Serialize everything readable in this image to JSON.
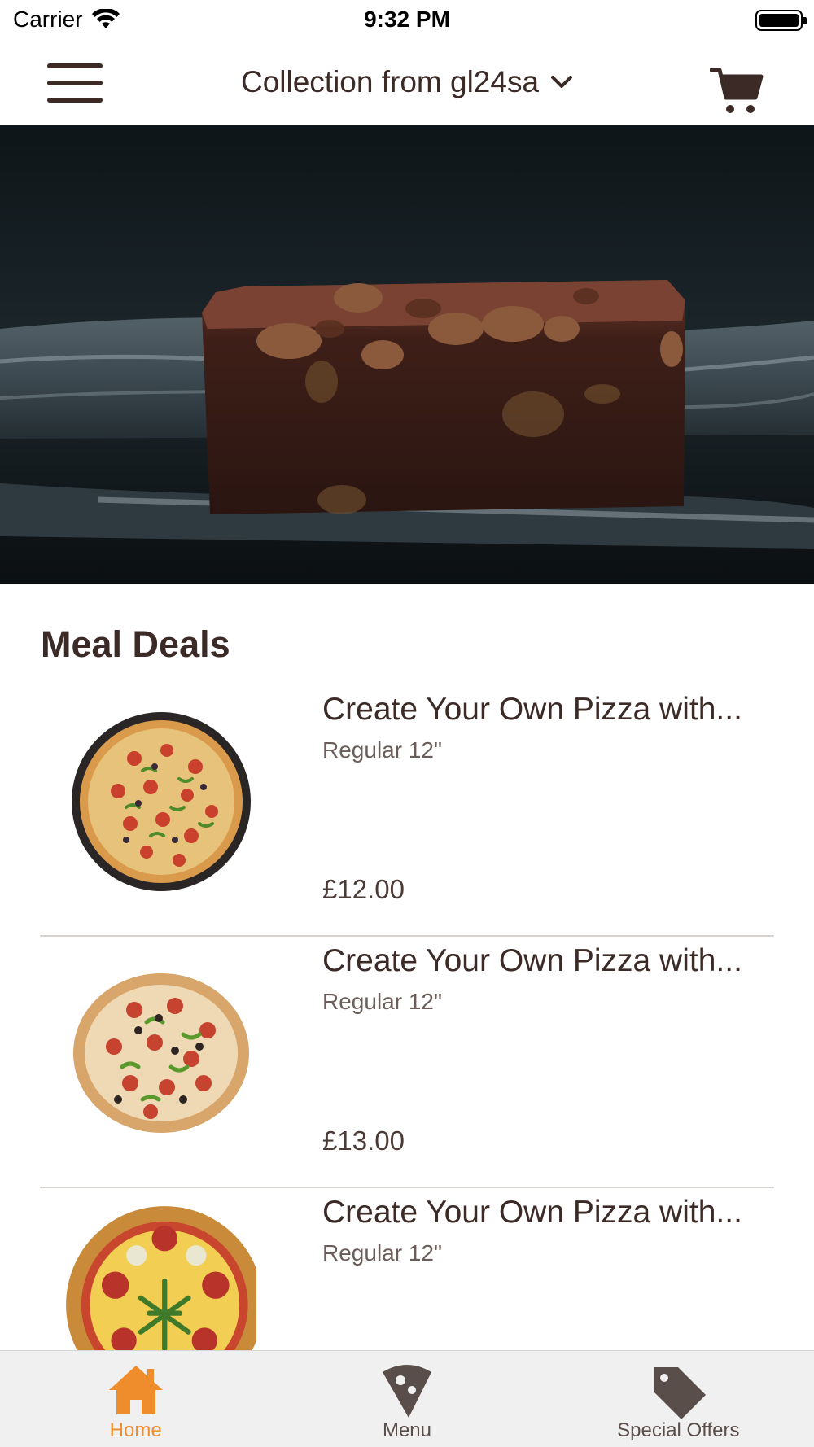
{
  "status_bar": {
    "carrier": "Carrier",
    "time": "9:32 PM"
  },
  "header": {
    "location_label": "Collection from gl24sa"
  },
  "hero": {
    "image_alt": "Chocolate walnut brownie"
  },
  "meal_deals": {
    "title": "Meal Deals",
    "items": [
      {
        "name": "Create Your Own Pizza with...",
        "size": "Regular 12\"",
        "price": "£12.00"
      },
      {
        "name": "Create Your Own Pizza with...",
        "size": "Regular 12\"",
        "price": "£13.00"
      },
      {
        "name": "Create Your Own Pizza with...",
        "size": "Regular 12\"",
        "price": ""
      }
    ]
  },
  "tab_bar": {
    "tabs": [
      {
        "label": "Home",
        "icon": "home-icon",
        "active": true
      },
      {
        "label": "Menu",
        "icon": "pizza-slice-icon",
        "active": false
      },
      {
        "label": "Special Offers",
        "icon": "tag-icon",
        "active": false
      }
    ]
  },
  "colors": {
    "accent": "#ef8d2c",
    "text": "#3b2a26",
    "tab_bar_bg": "#f1f0f0"
  }
}
